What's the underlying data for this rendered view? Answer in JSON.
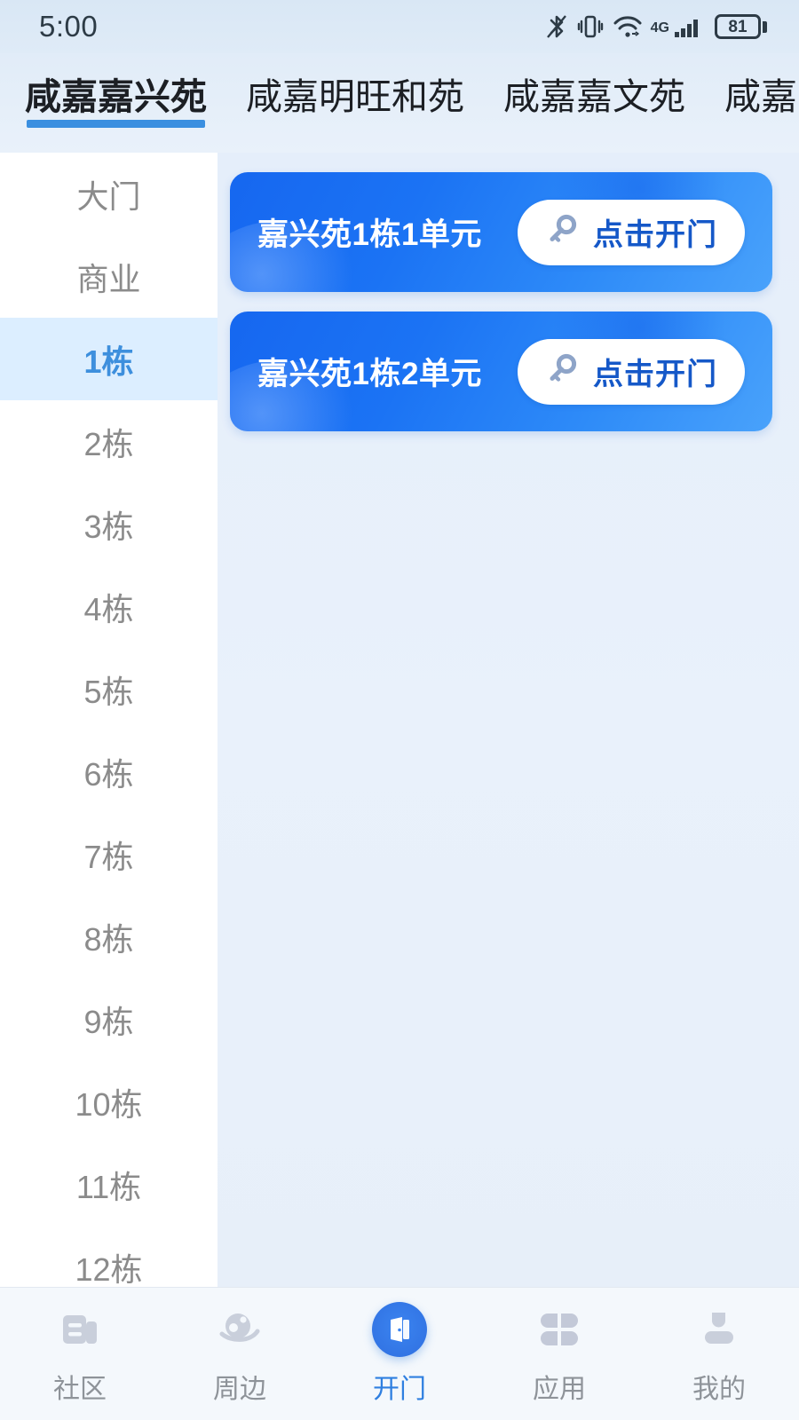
{
  "status_bar": {
    "time": "5:00",
    "network_label": "4G",
    "battery_percent": "81",
    "icons": [
      "bluetooth-icon",
      "vibrate-icon",
      "wifi-icon",
      "network-4g-icon",
      "signal-icon",
      "battery-icon"
    ]
  },
  "community_tabs": {
    "items": [
      {
        "label": "咸嘉嘉兴苑",
        "active": true
      },
      {
        "label": "咸嘉明旺和苑",
        "active": false
      },
      {
        "label": "咸嘉嘉文苑",
        "active": false
      },
      {
        "label": "咸嘉",
        "active": false
      }
    ]
  },
  "sidebar": {
    "items": [
      {
        "label": "大门",
        "active": false
      },
      {
        "label": "商业",
        "active": false
      },
      {
        "label": "1栋",
        "active": true
      },
      {
        "label": "2栋",
        "active": false
      },
      {
        "label": "3栋",
        "active": false
      },
      {
        "label": "4栋",
        "active": false
      },
      {
        "label": "5栋",
        "active": false
      },
      {
        "label": "6栋",
        "active": false
      },
      {
        "label": "7栋",
        "active": false
      },
      {
        "label": "8栋",
        "active": false
      },
      {
        "label": "9栋",
        "active": false
      },
      {
        "label": "10栋",
        "active": false
      },
      {
        "label": "11栋",
        "active": false
      },
      {
        "label": "12栋",
        "active": false
      }
    ]
  },
  "doors": {
    "open_button_label": "点击开门",
    "items": [
      {
        "name": "嘉兴苑1栋1单元",
        "button_label": "点击开门"
      },
      {
        "name": "嘉兴苑1栋2单元",
        "button_label": "点击开门"
      }
    ]
  },
  "bottom_nav": {
    "items": [
      {
        "label": "社区",
        "icon": "community-icon",
        "active": false
      },
      {
        "label": "周边",
        "icon": "planet-icon",
        "active": false
      },
      {
        "label": "开门",
        "icon": "door-icon",
        "active": true
      },
      {
        "label": "应用",
        "icon": "apps-icon",
        "active": false
      },
      {
        "label": "我的",
        "icon": "profile-icon",
        "active": false
      }
    ]
  },
  "colors": {
    "accent": "#2f7fe0",
    "card_blue_dark": "#1667f0",
    "card_blue_light": "#49a2fb",
    "button_text": "#1558c8",
    "sidebar_active_bg": "#dceeff",
    "sidebar_active_text": "#3d8fdd",
    "muted_text": "#8b8b8b",
    "page_bg": "#e8f0fa"
  }
}
